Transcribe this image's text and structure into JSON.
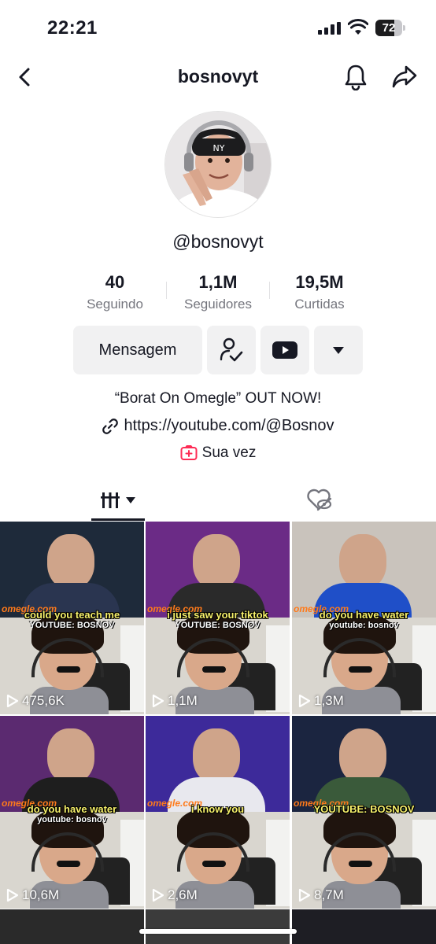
{
  "status_bar": {
    "time": "22:21",
    "battery_level": "72",
    "battery_fraction": 0.72,
    "icons": [
      "signal-icon",
      "wifi-icon",
      "battery-icon"
    ]
  },
  "header": {
    "title": "bosnovyt",
    "icons": [
      "back-icon",
      "bell-icon",
      "share-icon"
    ]
  },
  "profile": {
    "handle": "@bosnovyt",
    "stats": {
      "following_value": "40",
      "following_label": "Seguindo",
      "followers_value": "1,1M",
      "followers_label": "Seguidores",
      "likes_value": "19,5M",
      "likes_label": "Curtidas"
    },
    "actions": {
      "message_label": "Mensagem",
      "icons": [
        "following-check-icon",
        "youtube-icon",
        "dropdown-arrow-icon"
      ]
    },
    "bio": "“Borat On Omegle” OUT NOW!",
    "link": "https://youtube.com/@Bosnov",
    "now_playing": "Sua vez"
  },
  "tabs": {
    "icons": [
      "videos-grid-icon",
      "liked-hidden-icon"
    ],
    "selected": "videos"
  },
  "videos": [
    {
      "views": "475,6K",
      "caption": "could you teach me",
      "sub": "YOUTUBE: BOSNOV",
      "top_color": "#1e2a3a",
      "body_color": "#2a3550"
    },
    {
      "views": "1,1M",
      "caption": "i just saw your tiktok",
      "sub": "YOUTUBE: BOSNOV",
      "top_color": "#6b2b86",
      "body_color": "#2a2a2a"
    },
    {
      "views": "1,3M",
      "caption": "do you have water",
      "sub": "youtube: bosnov",
      "top_color": "#c9c3bc",
      "body_color": "#1f4fc8"
    },
    {
      "views": "10,6M",
      "caption": "do you have water",
      "sub": "youtube: bosnov",
      "top_color": "#5b2a70",
      "body_color": "#1e1e1e"
    },
    {
      "views": "2,6M",
      "caption": "i know you",
      "sub": "",
      "top_color": "#3d2a9a",
      "body_color": "#e8e8ee"
    },
    {
      "views": "8,7M",
      "caption": "YOUTUBE: BOSNOV",
      "sub": "",
      "top_color": "#1b2540",
      "body_color": "#3a5a3a"
    }
  ],
  "omegle_tag": "omegle.com"
}
